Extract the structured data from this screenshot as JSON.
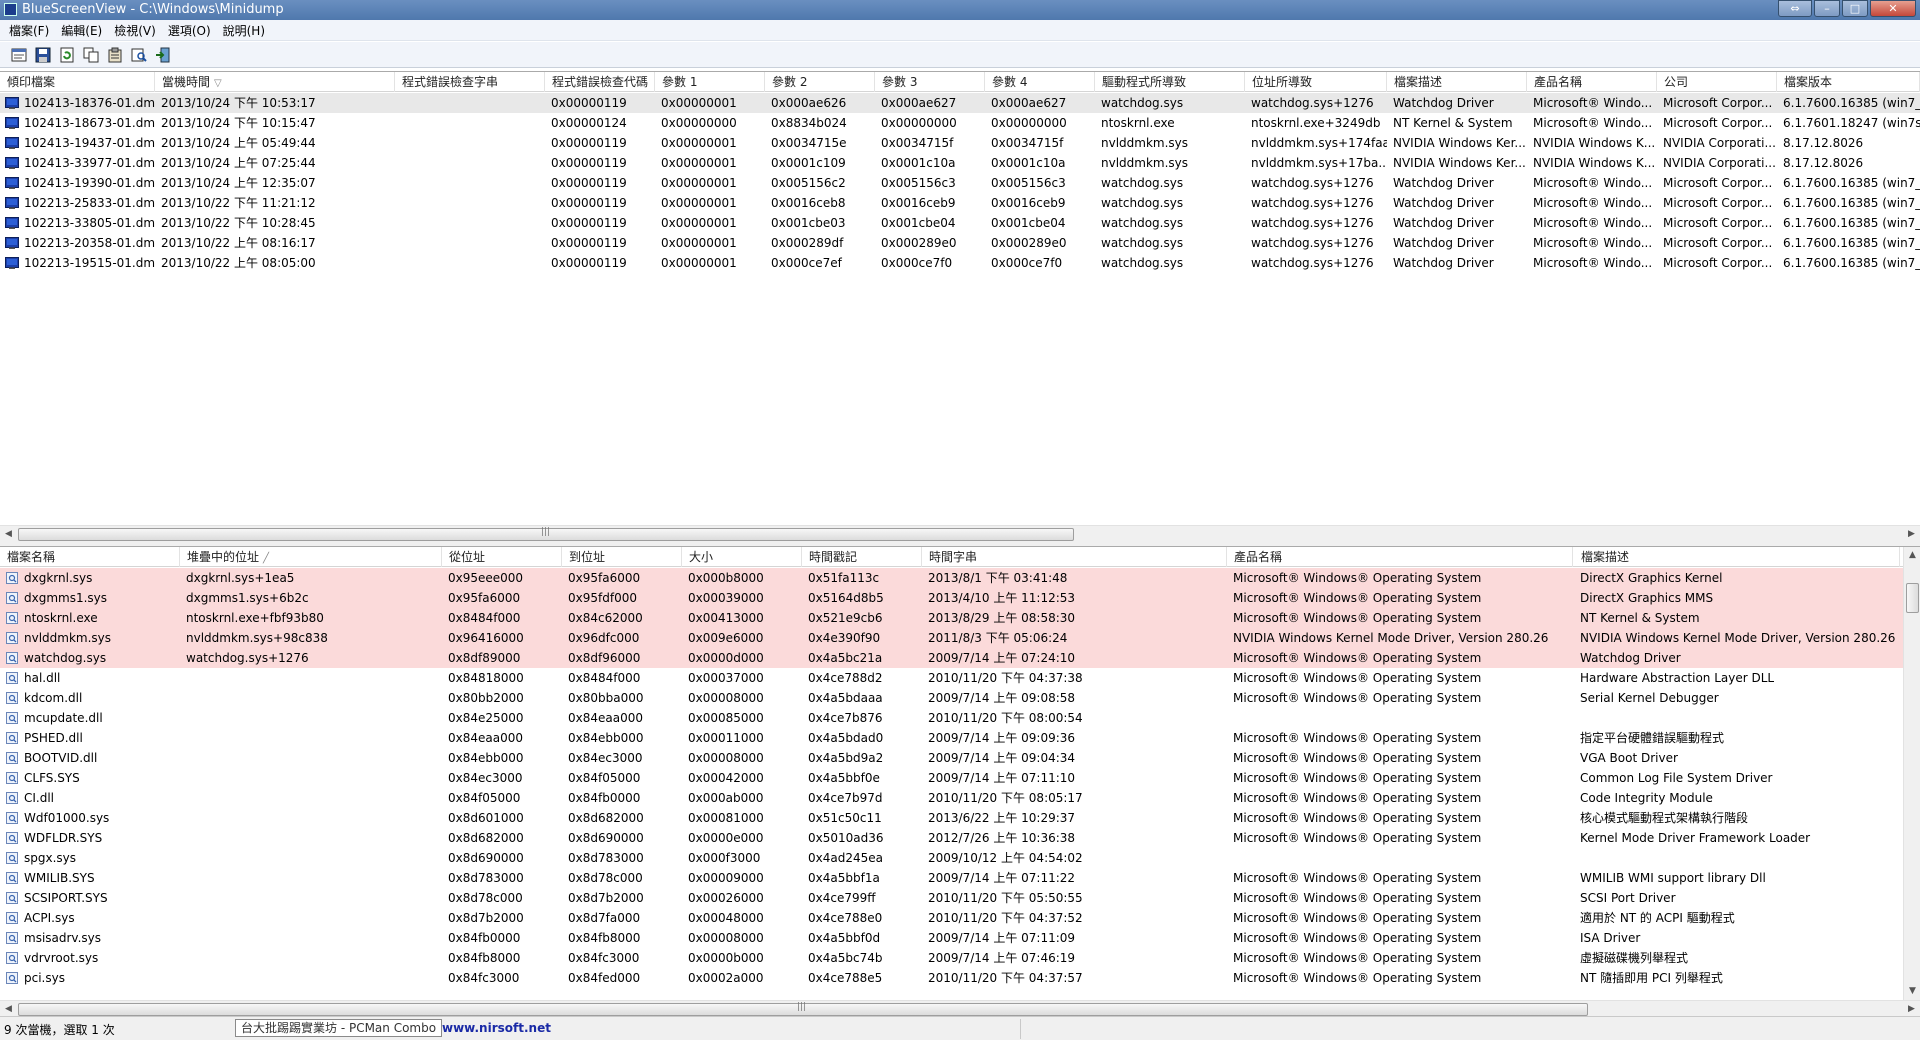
{
  "window": {
    "title": "BlueScreenView  -  C:\\Windows\\Minidump"
  },
  "menu": [
    "檔案(F)",
    "編輯(E)",
    "檢視(V)",
    "選項(O)",
    "說明(H)"
  ],
  "toolbar": [
    "save-html-report-icon",
    "save-icon",
    "refresh-icon",
    "copy-icon",
    "properties-icon",
    "find-icon",
    "exit-icon"
  ],
  "top_table": {
    "columns": [
      "傾印檔案",
      "當機時間",
      "程式錯誤檢查字串",
      "程式錯誤檢查代碼",
      "參數 1",
      "參數 2",
      "參數 3",
      "參數 4",
      "驅動程式所導致",
      "位址所導致",
      "檔案描述",
      "產品名稱",
      "公司",
      "檔案版本"
    ],
    "rows": [
      [
        "102413-18376-01.dmp",
        "2013/10/24 下午 10:53:17",
        "",
        "0x00000119",
        "0x00000001",
        "0x000ae626",
        "0x000ae627",
        "0x000ae627",
        "watchdog.sys",
        "watchdog.sys+1276",
        "Watchdog Driver",
        "Microsoft® Windo...",
        "Microsoft Corpor...",
        "6.1.7600.16385 (win7_rtm"
      ],
      [
        "102413-18673-01.dmp",
        "2013/10/24 下午 10:15:47",
        "",
        "0x00000124",
        "0x00000000",
        "0x8834b024",
        "0x00000000",
        "0x00000000",
        "ntoskrnl.exe",
        "ntoskrnl.exe+3249db",
        "NT Kernel & System",
        "Microsoft® Windo...",
        "Microsoft Corpor...",
        "6.1.7601.18247 (win7sp1"
      ],
      [
        "102413-19437-01.dmp",
        "2013/10/24 上午 05:49:44",
        "",
        "0x00000119",
        "0x00000001",
        "0x0034715e",
        "0x0034715f",
        "0x0034715f",
        "nvlddmkm.sys",
        "nvlddmkm.sys+174faa",
        "NVIDIA Windows Ker...",
        "NVIDIA Windows K...",
        "NVIDIA Corporati...",
        "8.17.12.8026"
      ],
      [
        "102413-33977-01.dmp",
        "2013/10/24 上午 07:25:44",
        "",
        "0x00000119",
        "0x00000001",
        "0x0001c109",
        "0x0001c10a",
        "0x0001c10a",
        "nvlddmkm.sys",
        "nvlddmkm.sys+17ba...",
        "NVIDIA Windows Ker...",
        "NVIDIA Windows K...",
        "NVIDIA Corporati...",
        "8.17.12.8026"
      ],
      [
        "102413-19390-01.dmp",
        "2013/10/24 上午 12:35:07",
        "",
        "0x00000119",
        "0x00000001",
        "0x005156c2",
        "0x005156c3",
        "0x005156c3",
        "watchdog.sys",
        "watchdog.sys+1276",
        "Watchdog Driver",
        "Microsoft® Windo...",
        "Microsoft Corpor...",
        "6.1.7600.16385 (win7_rtm"
      ],
      [
        "102213-25833-01.dmp",
        "2013/10/22 下午 11:21:12",
        "",
        "0x00000119",
        "0x00000001",
        "0x0016ceb8",
        "0x0016ceb9",
        "0x0016ceb9",
        "watchdog.sys",
        "watchdog.sys+1276",
        "Watchdog Driver",
        "Microsoft® Windo...",
        "Microsoft Corpor...",
        "6.1.7600.16385 (win7_rtm"
      ],
      [
        "102213-33805-01.dmp",
        "2013/10/22 下午 10:28:45",
        "",
        "0x00000119",
        "0x00000001",
        "0x001cbe03",
        "0x001cbe04",
        "0x001cbe04",
        "watchdog.sys",
        "watchdog.sys+1276",
        "Watchdog Driver",
        "Microsoft® Windo...",
        "Microsoft Corpor...",
        "6.1.7600.16385 (win7_rtm"
      ],
      [
        "102213-20358-01.dmp",
        "2013/10/22 上午 08:16:17",
        "",
        "0x00000119",
        "0x00000001",
        "0x000289df",
        "0x000289e0",
        "0x000289e0",
        "watchdog.sys",
        "watchdog.sys+1276",
        "Watchdog Driver",
        "Microsoft® Windo...",
        "Microsoft Corpor...",
        "6.1.7600.16385 (win7_rtm"
      ],
      [
        "102213-19515-01.dmp",
        "2013/10/22 上午 08:05:00",
        "",
        "0x00000119",
        "0x00000001",
        "0x000ce7ef",
        "0x000ce7f0",
        "0x000ce7f0",
        "watchdog.sys",
        "watchdog.sys+1276",
        "Watchdog Driver",
        "Microsoft® Windo...",
        "Microsoft Corpor...",
        "6.1.7600.16385 (win7_rtm"
      ]
    ]
  },
  "bottom_table": {
    "columns": [
      "檔案名稱",
      "堆疊中的位址",
      "從位址",
      "到位址",
      "大小",
      "時間戳記",
      "時間字串",
      "產品名稱",
      "檔案描述"
    ],
    "rows": [
      [
        "dxgkrnl.sys",
        "dxgkrnl.sys+1ea5",
        "0x95eee000",
        "0x95fa6000",
        "0x000b8000",
        "0x51fa113c",
        "2013/8/1 下午 03:41:48",
        "Microsoft® Windows® Operating System",
        "DirectX Graphics Kernel"
      ],
      [
        "dxgmms1.sys",
        "dxgmms1.sys+6b2c",
        "0x95fa6000",
        "0x95fdf000",
        "0x00039000",
        "0x5164d8b5",
        "2013/4/10 上午 11:12:53",
        "Microsoft® Windows® Operating System",
        "DirectX Graphics MMS"
      ],
      [
        "ntoskrnl.exe",
        "ntoskrnl.exe+fbf93b80",
        "0x8484f000",
        "0x84c62000",
        "0x00413000",
        "0x521e9cb6",
        "2013/8/29 上午 08:58:30",
        "Microsoft® Windows® Operating System",
        "NT Kernel & System"
      ],
      [
        "nvlddmkm.sys",
        "nvlddmkm.sys+98c838",
        "0x96416000",
        "0x96dfc000",
        "0x009e6000",
        "0x4e390f90",
        "2011/8/3 下午 05:06:24",
        "NVIDIA Windows Kernel Mode Driver, Version 280.26",
        "NVIDIA Windows Kernel Mode Driver, Version 280.26"
      ],
      [
        "watchdog.sys",
        "watchdog.sys+1276",
        "0x8df89000",
        "0x8df96000",
        "0x0000d000",
        "0x4a5bc21a",
        "2009/7/14 上午 07:24:10",
        "Microsoft® Windows® Operating System",
        "Watchdog Driver"
      ],
      [
        "hal.dll",
        "",
        "0x84818000",
        "0x8484f000",
        "0x00037000",
        "0x4ce788d2",
        "2010/11/20 下午 04:37:38",
        "Microsoft® Windows® Operating System",
        "Hardware Abstraction Layer DLL"
      ],
      [
        "kdcom.dll",
        "",
        "0x80bb2000",
        "0x80bba000",
        "0x00008000",
        "0x4a5bdaaa",
        "2009/7/14 上午 09:08:58",
        "Microsoft® Windows® Operating System",
        "Serial Kernel Debugger"
      ],
      [
        "mcupdate.dll",
        "",
        "0x84e25000",
        "0x84eaa000",
        "0x00085000",
        "0x4ce7b876",
        "2010/11/20 下午 08:00:54",
        "",
        ""
      ],
      [
        "PSHED.dll",
        "",
        "0x84eaa000",
        "0x84ebb000",
        "0x00011000",
        "0x4a5bdad0",
        "2009/7/14 上午 09:09:36",
        "Microsoft® Windows® Operating System",
        "指定平台硬體錯誤驅動程式"
      ],
      [
        "BOOTVID.dll",
        "",
        "0x84ebb000",
        "0x84ec3000",
        "0x00008000",
        "0x4a5bd9a2",
        "2009/7/14 上午 09:04:34",
        "Microsoft® Windows® Operating System",
        "VGA Boot Driver"
      ],
      [
        "CLFS.SYS",
        "",
        "0x84ec3000",
        "0x84f05000",
        "0x00042000",
        "0x4a5bbf0e",
        "2009/7/14 上午 07:11:10",
        "Microsoft® Windows® Operating System",
        "Common Log File System Driver"
      ],
      [
        "CI.dll",
        "",
        "0x84f05000",
        "0x84fb0000",
        "0x000ab000",
        "0x4ce7b97d",
        "2010/11/20 下午 08:05:17",
        "Microsoft® Windows® Operating System",
        "Code Integrity Module"
      ],
      [
        "Wdf01000.sys",
        "",
        "0x8d601000",
        "0x8d682000",
        "0x00081000",
        "0x51c50c11",
        "2013/6/22 上午 10:29:37",
        "Microsoft® Windows® Operating System",
        "核心模式驅動程式架構執行階段"
      ],
      [
        "WDFLDR.SYS",
        "",
        "0x8d682000",
        "0x8d690000",
        "0x0000e000",
        "0x5010ad36",
        "2012/7/26 上午 10:36:38",
        "Microsoft® Windows® Operating System",
        "Kernel Mode Driver Framework Loader"
      ],
      [
        "spgx.sys",
        "",
        "0x8d690000",
        "0x8d783000",
        "0x000f3000",
        "0x4ad245ea",
        "2009/10/12 上午 04:54:02",
        "",
        ""
      ],
      [
        "WMILIB.SYS",
        "",
        "0x8d783000",
        "0x8d78c000",
        "0x00009000",
        "0x4a5bbf1a",
        "2009/7/14 上午 07:11:22",
        "Microsoft® Windows® Operating System",
        "WMILIB WMI support library Dll"
      ],
      [
        "SCSIPORT.SYS",
        "",
        "0x8d78c000",
        "0x8d7b2000",
        "0x00026000",
        "0x4ce799ff",
        "2010/11/20 下午 05:50:55",
        "Microsoft® Windows® Operating System",
        "SCSI Port Driver"
      ],
      [
        "ACPI.sys",
        "",
        "0x8d7b2000",
        "0x8d7fa000",
        "0x00048000",
        "0x4ce788e0",
        "2010/11/20 下午 04:37:52",
        "Microsoft® Windows® Operating System",
        "適用於 NT 的 ACPI 驅動程式"
      ],
      [
        "msisadrv.sys",
        "",
        "0x84fb0000",
        "0x84fb8000",
        "0x00008000",
        "0x4a5bbf0d",
        "2009/7/14 上午 07:11:09",
        "Microsoft® Windows® Operating System",
        "ISA Driver"
      ],
      [
        "vdrvroot.sys",
        "",
        "0x84fb8000",
        "0x84fc3000",
        "0x0000b000",
        "0x4a5bc74b",
        "2009/7/14 上午 07:46:19",
        "Microsoft® Windows® Operating System",
        "虛擬磁碟機列舉程式"
      ],
      [
        "pci.sys",
        "",
        "0x84fc3000",
        "0x84fed000",
        "0x0002a000",
        "0x4ce788e5",
        "2010/11/20 下午 04:37:57",
        "Microsoft® Windows® Operating System",
        "NT 隨插即用 PCI 列舉程式"
      ]
    ]
  },
  "status": {
    "count": "9 次當機，選取 1 次",
    "tooltip": "台大批踢踢實業坊 - PCMan Combo",
    "link": "www.nirsoft.net"
  },
  "colors": {
    "highlight_row": "#fbdada",
    "selected_row": "#e8e8e8",
    "link": "#1a2aa6"
  }
}
